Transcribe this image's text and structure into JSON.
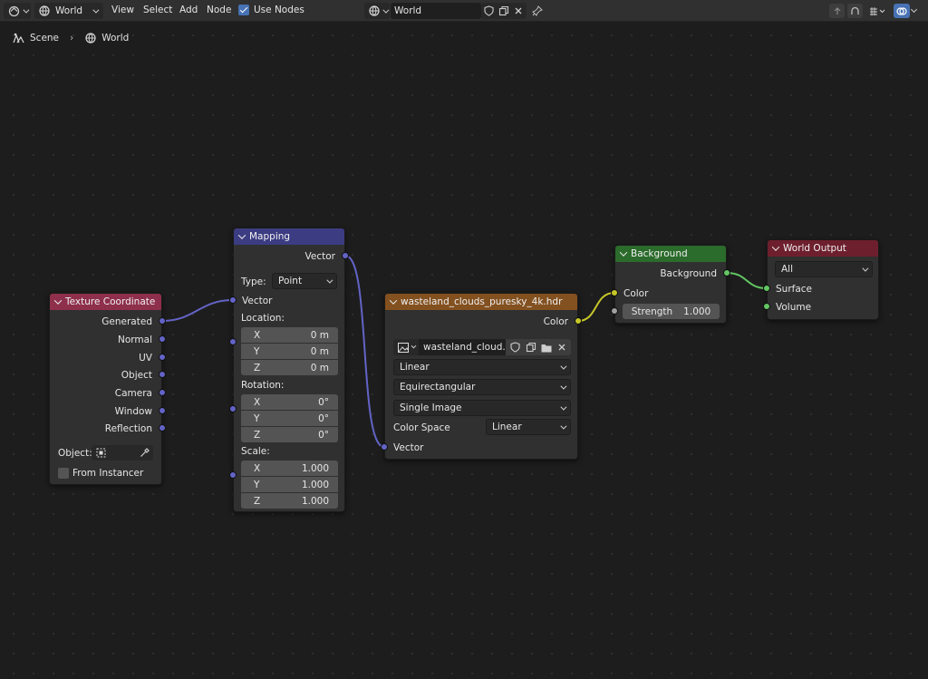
{
  "header": {
    "editor_type_icon": "node-editor-icon",
    "shader_type": "World",
    "menus": [
      "View",
      "Select",
      "Add",
      "Node"
    ],
    "use_nodes_label": "Use Nodes",
    "use_nodes_checked": true,
    "datablock_name": "World"
  },
  "breadcrumb": {
    "scene": "Scene",
    "world": "World"
  },
  "nodes": {
    "texture_coordinate": {
      "title": "Texture Coordinate",
      "header_color": "#8e2f4b",
      "outputs": [
        "Generated",
        "Normal",
        "UV",
        "Object",
        "Camera",
        "Window",
        "Reflection"
      ],
      "object_label": "Object:",
      "from_instancer_label": "From Instancer"
    },
    "mapping": {
      "title": "Mapping",
      "header_color": "#3c3c83",
      "output": "Vector",
      "type_label": "Type:",
      "type_value": "Point",
      "vector_input": "Vector",
      "location_label": "Location:",
      "location": [
        {
          "axis": "X",
          "value": "0 m"
        },
        {
          "axis": "Y",
          "value": "0 m"
        },
        {
          "axis": "Z",
          "value": "0 m"
        }
      ],
      "rotation_label": "Rotation:",
      "rotation": [
        {
          "axis": "X",
          "value": "0°"
        },
        {
          "axis": "Y",
          "value": "0°"
        },
        {
          "axis": "Z",
          "value": "0°"
        }
      ],
      "scale_label": "Scale:",
      "scale": [
        {
          "axis": "X",
          "value": "1.000"
        },
        {
          "axis": "Y",
          "value": "1.000"
        },
        {
          "axis": "Z",
          "value": "1.000"
        }
      ]
    },
    "environment_texture": {
      "title": "wasteland_clouds_puresky_4k.hdr",
      "header_color": "#83501f",
      "output": "Color",
      "image_name": "wasteland_cloud...",
      "interpolation": "Linear",
      "projection": "Equirectangular",
      "source": "Single Image",
      "color_space_label": "Color Space",
      "color_space_value": "Linear",
      "vector_input": "Vector"
    },
    "background": {
      "title": "Background",
      "header_color": "#2b6b2b",
      "output": "Background",
      "color_input": "Color",
      "strength_label": "Strength",
      "strength_value": "1.000"
    },
    "world_output": {
      "title": "World Output",
      "header_color": "#6e1f2e",
      "target": "All",
      "inputs": [
        "Surface",
        "Volume"
      ]
    }
  },
  "colors": {
    "vector_socket": "#6363c7",
    "color_socket": "#c7c729",
    "shader_socket": "#63c763",
    "float_socket": "#a1a1a1"
  }
}
